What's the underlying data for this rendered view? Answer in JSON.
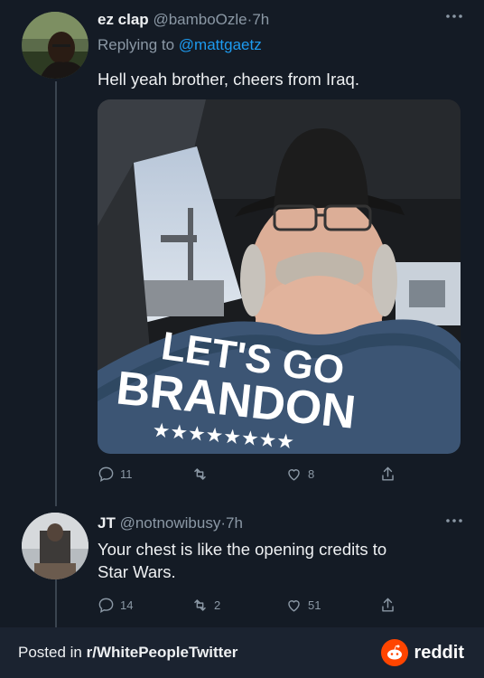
{
  "tweet1": {
    "display_name": "ez clap",
    "handle": "@bamboOzle",
    "time": "7h",
    "replying_label": "Replying to",
    "replying_to": "@mattgaetz",
    "text": "Hell yeah brother, cheers from Iraq.",
    "shirt_text": [
      "LET'S GO",
      "BRANDON"
    ],
    "stats": {
      "replies": "11",
      "retweets": "",
      "likes": "8"
    }
  },
  "tweet2": {
    "display_name": "JT",
    "handle": "@notnowibusy",
    "time": "7h",
    "text_line1": "Your chest is like the opening credits to",
    "text_line2": "Star Wars.",
    "stats": {
      "replies": "14",
      "retweets": "2",
      "likes": "51"
    }
  },
  "separator": "·",
  "footer": {
    "posted_prefix": "Posted in ",
    "subreddit": "r/WhitePeopleTwitter",
    "brand": "reddit"
  },
  "icons": {
    "reply": "reply-icon",
    "retweet": "retweet-icon",
    "like": "heart-icon",
    "share": "share-icon",
    "more": "more-icon",
    "reddit": "reddit-logo-icon"
  },
  "colors": {
    "background": "#141b25",
    "mention": "#1d9bf0",
    "muted": "#8b98a5",
    "reddit_orange": "#ff4500"
  }
}
